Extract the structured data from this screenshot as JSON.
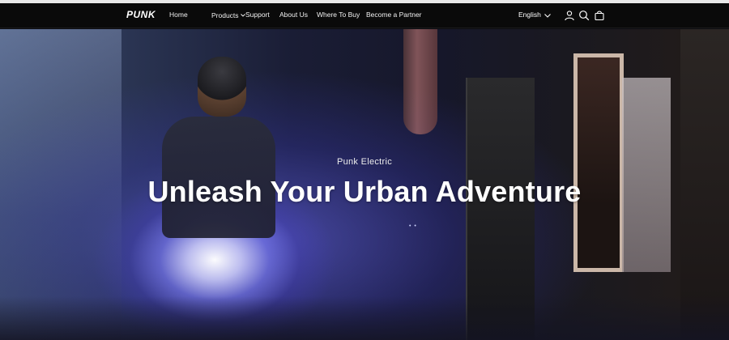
{
  "brand": {
    "logo_text": "PUNK"
  },
  "nav": {
    "items": [
      {
        "label": "Home"
      },
      {
        "label": "Products",
        "has_dropdown": true
      },
      {
        "label": "Support"
      },
      {
        "label": "About Us"
      },
      {
        "label": "Where To Buy"
      },
      {
        "label": "Become a Partner"
      }
    ],
    "language": "English"
  },
  "icons": [
    "account-icon",
    "search-icon",
    "cart-icon"
  ],
  "hero": {
    "eyebrow": "Punk Electric",
    "headline": "Unleash Your Urban Adventure",
    "carousel_indicator": "• •"
  },
  "colors": {
    "nav_bg": "#0a0a0a",
    "text": "#ffffff",
    "hero_glow": "#8080ff"
  }
}
